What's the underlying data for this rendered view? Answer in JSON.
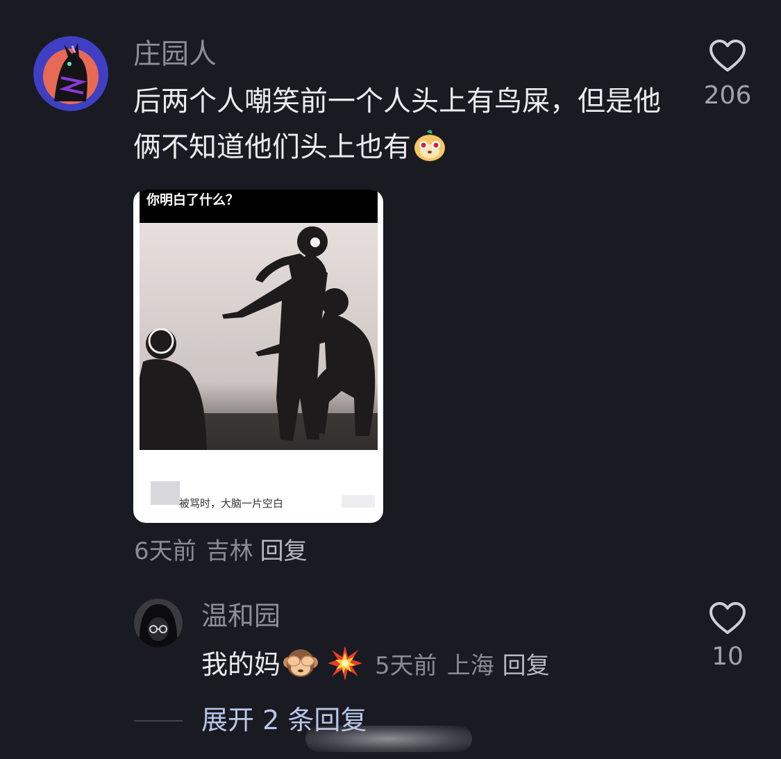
{
  "main_comment": {
    "username": "庄园人",
    "text": "后两个人嘲笑前一个人头上有鸟屎，但是他俩不知道他们头上也有",
    "emoji_icon": "monkey-face-emoji",
    "like_count": "206",
    "image": {
      "title": "你明白了什么？",
      "caption": "被骂时，大脑一片空白"
    },
    "time": "6天前",
    "location": "吉林",
    "reply_label": "回复"
  },
  "reply_comment": {
    "username": "温和园",
    "text": "我的妈",
    "emojis": [
      "see-no-evil-monkey-emoji",
      "collision-emoji"
    ],
    "time": "5天前",
    "location": "上海",
    "reply_label": "回复",
    "like_count": "10"
  },
  "expand_replies": {
    "label": "展开 2 条回复"
  },
  "colors": {
    "background": "#1a1a22",
    "text_primary": "#ececf0",
    "text_secondary": "#8e8e96",
    "link": "#b8c7e8"
  }
}
